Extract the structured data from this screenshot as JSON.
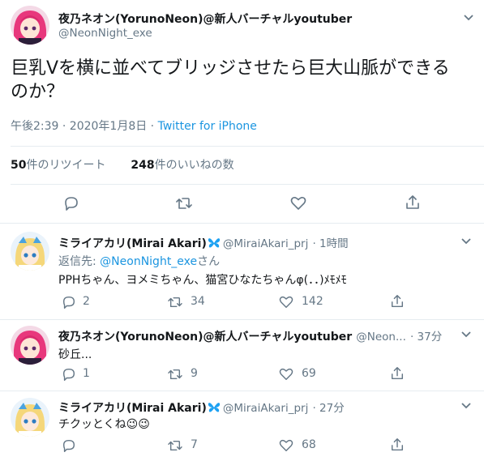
{
  "main_tweet": {
    "author_name": "夜乃ネオン(YorunoNeon)@新人バーチャルyoutuber",
    "author_handle": "@NeonNight_exe",
    "text_line1": "巨乳Vを横に並べてブリッジさせたら巨大山脈ができる",
    "text_line2": "のか？",
    "time": "午後2:39 · 2020年1月8日 ·",
    "source": "Twitter for iPhone",
    "retweets_count": "50",
    "retweets_label": "件のリツイート",
    "likes_count": "248",
    "likes_label": "件のいいねの数"
  },
  "replies": [
    {
      "author_name": "ミライアカリ(Mirai Akari)",
      "author_handle": "@MiraiAkari_prj",
      "time": "· 1時間",
      "reply_to_label": "返信先:",
      "reply_to_handle": "@NeonNight_exe",
      "reply_to_suffix": "さん",
      "text": "PPHちゃん、ヨメミちゃん、猫宮ひなたちゃんφ(．．)ﾒﾓﾒﾓ",
      "reply_count": "2",
      "retweet_count": "34",
      "like_count": "142"
    },
    {
      "author_name": "夜乃ネオン(YorunoNeon)@新人バーチャルyoutuber",
      "author_handle": "@Neon...",
      "time": "· 37分",
      "text": "砂丘...",
      "reply_count": "1",
      "retweet_count": "9",
      "like_count": "69"
    },
    {
      "author_name": "ミライアカリ(Mirai Akari)",
      "author_handle": "@MiraiAkari_prj",
      "time": "· 27分",
      "text": "チクッとくね",
      "emoji": "😉😉",
      "reply_count": "",
      "retweet_count": "7",
      "like_count": "68"
    }
  ],
  "colors": {
    "link": "#1b95e0",
    "secondary_text": "#657786",
    "divider": "#e6ecf0",
    "butterfly": "#1da1f2"
  },
  "icons": [
    "chevron-down-icon",
    "reply-icon",
    "retweet-icon",
    "like-icon",
    "share-icon",
    "butterfly-emoji-icon"
  ]
}
